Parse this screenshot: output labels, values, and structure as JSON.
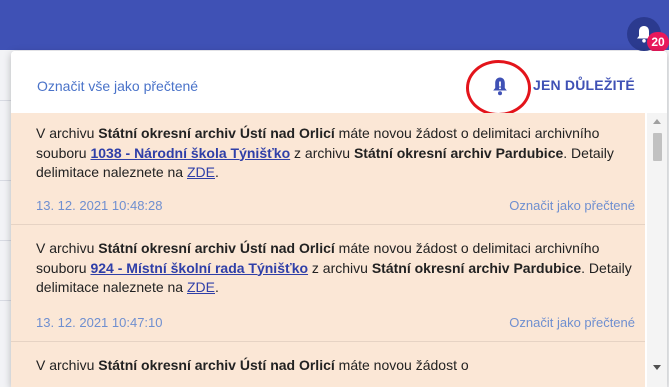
{
  "topbar": {
    "badge_count": "20"
  },
  "panel": {
    "mark_all_label": "Označit vše jako přečtené",
    "important_label": "JEN DŮLEŽITÉ"
  },
  "notifications": [
    {
      "t1": "V archivu ",
      "archive": "Státní okresní archiv Ústí nad Orlicí",
      "t2": " máte novou žádost o delimitaci archivního souboru ",
      "fond": "1038 - Národní škola Týnišťko",
      "t3": " z archivu ",
      "source": "Státní okresní archiv Pardubice",
      "t4": ". Detaily delimitace naleznete na ",
      "link": "ZDE",
      "t5": ".",
      "time": "13. 12. 2021 10:48:28",
      "mark_read": "Označit jako přečtené"
    },
    {
      "t1": "V archivu ",
      "archive": "Státní okresní archiv Ústí nad Orlicí",
      "t2": " máte novou žádost o delimitaci archivního souboru ",
      "fond": "924 - Místní školní rada Týnišťko",
      "t3": " z archivu ",
      "source": "Státní okresní archiv Pardubice",
      "t4": ". Detaily delimitace naleznete na ",
      "link": "ZDE",
      "t5": ".",
      "time": "13. 12. 2021 10:47:10",
      "mark_read": "Označit jako přečtené"
    },
    {
      "t1": "V archivu ",
      "archive": "Státní okresní archiv Ústí nad Orlicí",
      "t2": " máte novou žádost o"
    }
  ]
}
